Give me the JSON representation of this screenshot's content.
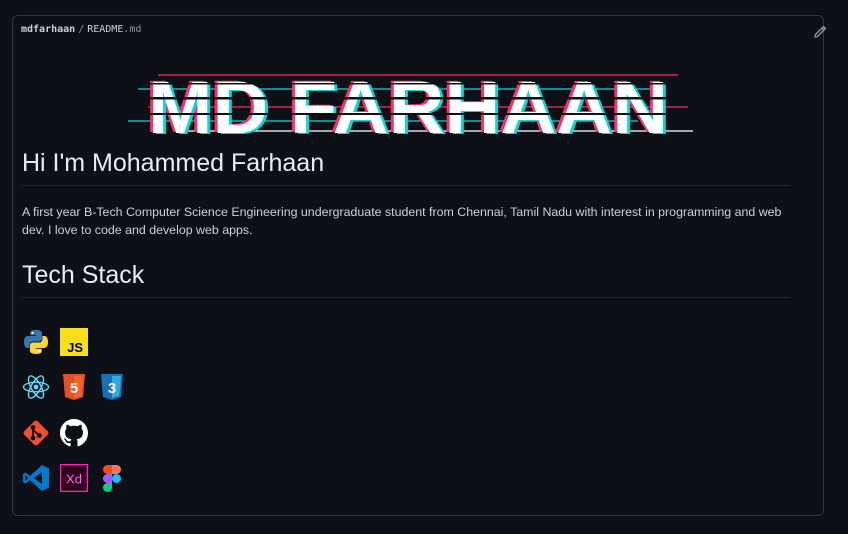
{
  "breadcrumb": {
    "user": "mdfarhaan",
    "separator": "/",
    "file": "README",
    "ext": ".md"
  },
  "banner": {
    "text": "MD FARHAAN"
  },
  "heading": "Hi I'm Mohammed Farhaan",
  "intro": "A first year B-Tech Computer Science Engineering undergraduate student from Chennai, Tamil Nadu with interest in programming and web dev. I love to code and develop web apps.",
  "tech_heading": "Tech Stack",
  "tech_rows": [
    [
      "python-icon",
      "javascript-icon"
    ],
    [
      "react-icon",
      "html5-icon",
      "css3-icon"
    ],
    [
      "git-icon",
      "github-icon"
    ],
    [
      "vscode-icon",
      "adobe-xd-icon",
      "figma-icon"
    ]
  ],
  "icon_text": {
    "js": "JS",
    "html": "5",
    "css": "3",
    "xd": "Xd"
  },
  "colors": {
    "background": "#0d1117",
    "border": "#30363d",
    "text": "#c9d1d9",
    "banner_fill": "#ffffff",
    "glitch_red": "#ff2e63",
    "glitch_cyan": "#08d9d6"
  }
}
